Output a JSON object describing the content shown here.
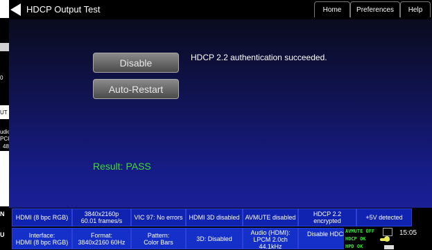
{
  "header": {
    "title": "HDCP Output Test",
    "nav": [
      "Home",
      "Preferences",
      "Help"
    ]
  },
  "main": {
    "disable_label": "Disable",
    "autorestart_label": "Auto-Restart",
    "message": "HDCP 2.2 authentication succeeded.",
    "result": "Result: PASS",
    "result_color": "#3fdc2b"
  },
  "status_row1": [
    {
      "lines": [
        "HDMI (8 bpc RGB)"
      ]
    },
    {
      "lines": [
        "3840x2160p",
        "60.01 frames/s"
      ]
    },
    {
      "lines": [
        "VIC 97: No errors"
      ]
    },
    {
      "lines": [
        "HDMI 3D disabled"
      ]
    },
    {
      "lines": [
        "AVMUTE disabled"
      ]
    },
    {
      "lines": [
        "HDCP 2.2",
        "encrypted"
      ]
    },
    {
      "lines": [
        "+5V detected"
      ]
    }
  ],
  "status_row2": [
    {
      "lines": [
        "Interface:",
        "HDMI (8 bpc RGB)"
      ]
    },
    {
      "lines": [
        "Format:",
        "3840x2160 60Hz"
      ]
    },
    {
      "lines": [
        "Pattern:",
        "Color Bars"
      ]
    },
    {
      "lines": [
        "3D: Disabled"
      ]
    },
    {
      "lines": [
        "Audio (HDMI):",
        "LPCM 2.0ch",
        "44.1kHz"
      ]
    },
    {
      "lines": [
        "Disable HDCP"
      ]
    }
  ],
  "indicators": {
    "avmute": "AVMUTE OFF",
    "hdcp": "HDCP OK",
    "hpd": "HPD OK"
  },
  "clock": "15:05",
  "left_strip": {
    "items": [
      "0",
      "UT",
      "udio",
      "PCI",
      "48",
      "N",
      "U"
    ]
  }
}
